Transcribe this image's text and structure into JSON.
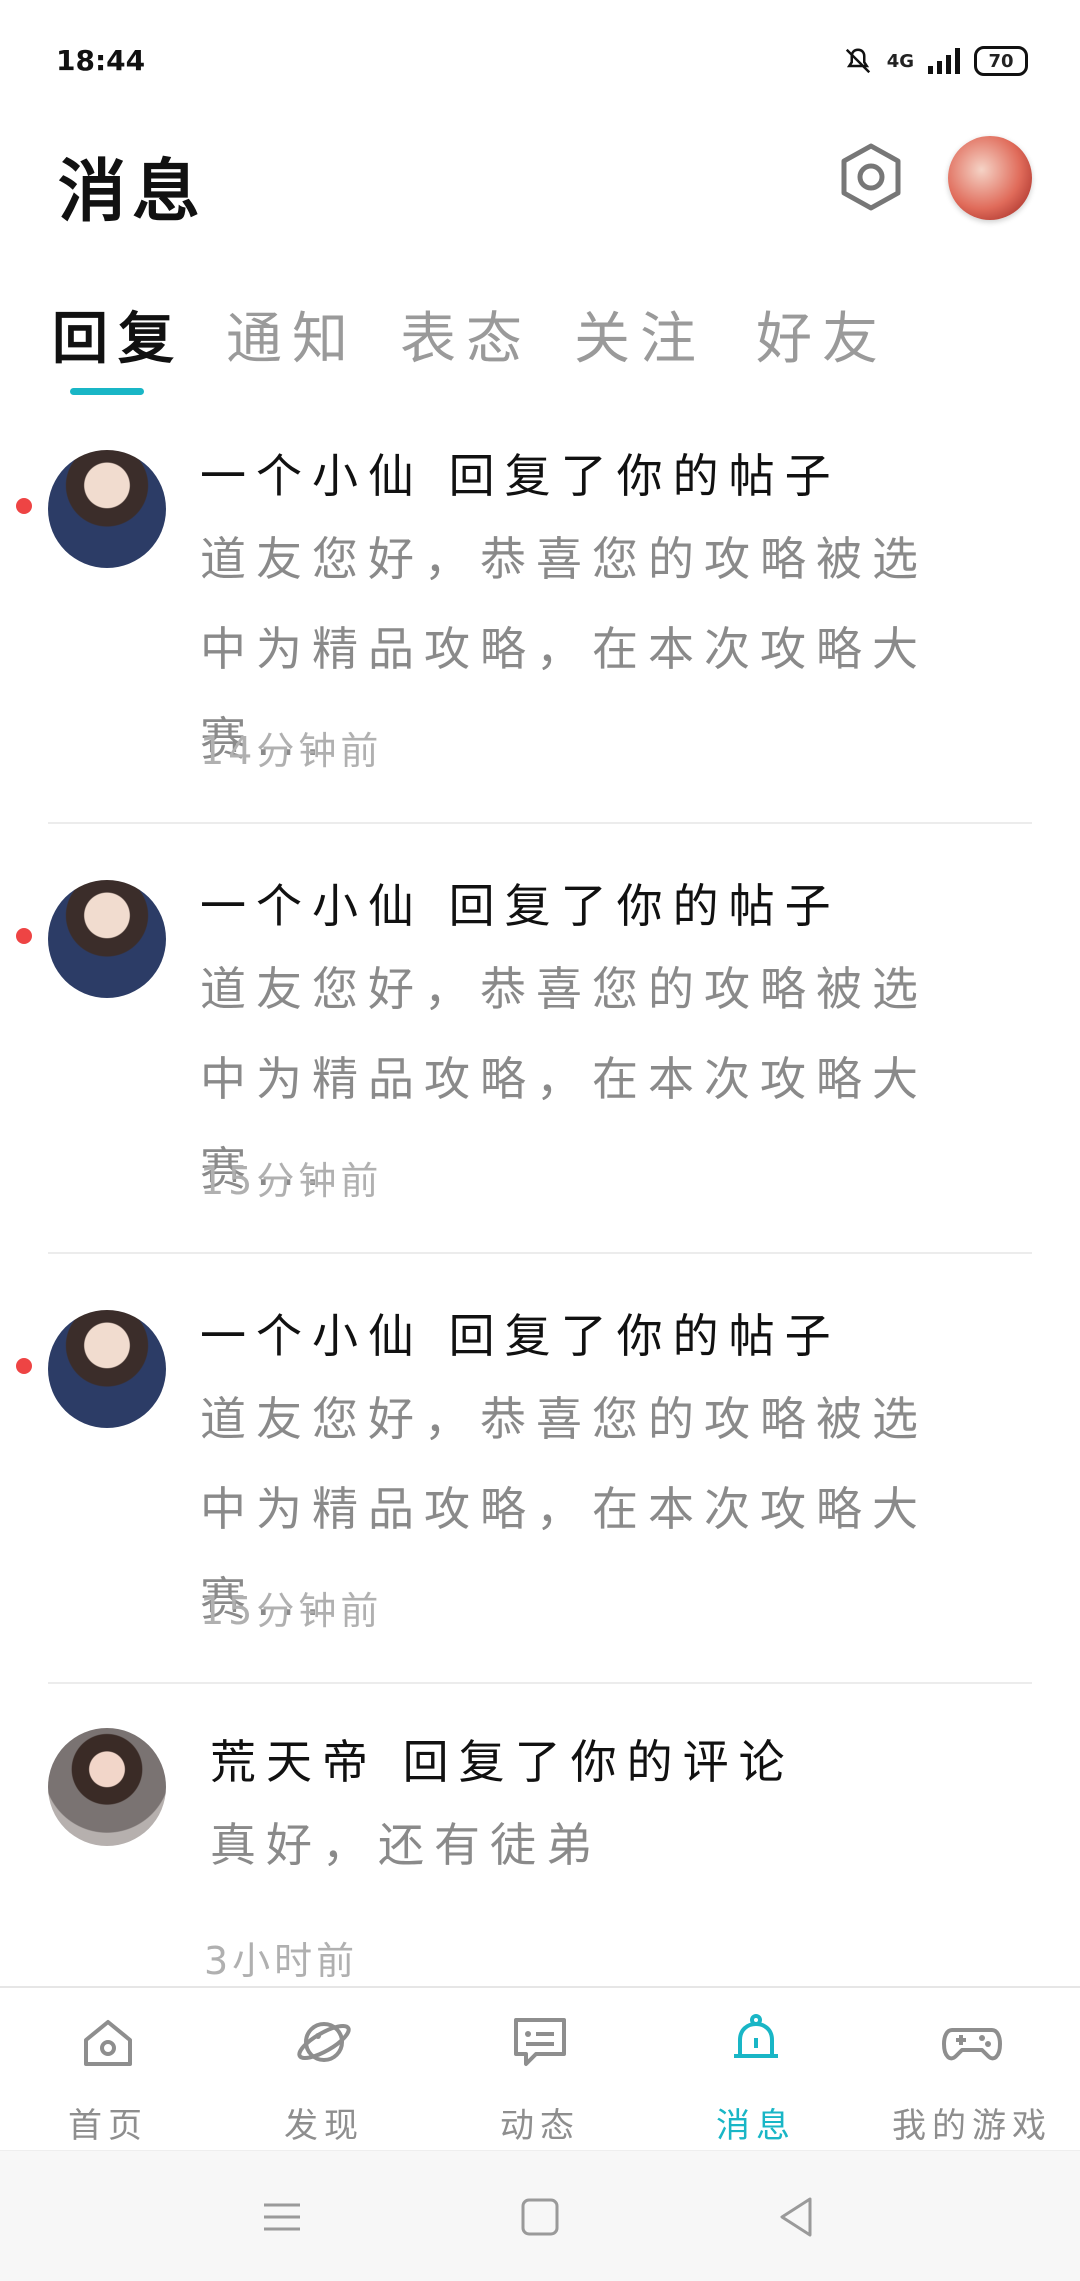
{
  "status": {
    "time": "18:44",
    "network": "4G",
    "battery": "70"
  },
  "header": {
    "title": "消息"
  },
  "tabs": [
    "回复",
    "通知",
    "表态",
    "关注",
    "好友"
  ],
  "messages": [
    {
      "title": "一个小仙 回复了你的帖子",
      "body": "道友您好，恭喜您的攻略被选中为精品攻略，在本次攻略大赛...",
      "time": "14分钟前"
    },
    {
      "title": "一个小仙 回复了你的帖子",
      "body": "道友您好，恭喜您的攻略被选中为精品攻略，在本次攻略大赛...",
      "time": "15分钟前"
    },
    {
      "title": "一个小仙 回复了你的帖子",
      "body": "道友您好，恭喜您的攻略被选中为精品攻略，在本次攻略大赛...",
      "time": "15分钟前"
    },
    {
      "title": "荒天帝 回复了你的评论",
      "body": "真好，还有徒弟",
      "time": "3小时前"
    }
  ],
  "nav": {
    "items": [
      "首页",
      "发现",
      "动态",
      "消息",
      "我的游戏"
    ],
    "active_color": "#19b6c6"
  },
  "icons": {
    "settings": "settings-icon",
    "home": "home-icon",
    "discover": "planet-icon",
    "activity": "chat-card-icon",
    "messages": "bell-icon",
    "games": "gamepad-icon"
  }
}
